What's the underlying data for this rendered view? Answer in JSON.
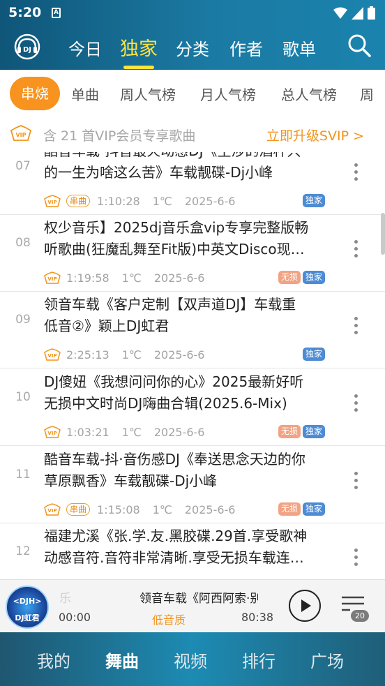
{
  "status": {
    "time": "5:20",
    "a_icon": "A"
  },
  "topnav": {
    "logo_text": "DJ",
    "tabs": [
      {
        "label": "今日"
      },
      {
        "label": "独家"
      },
      {
        "label": "分类"
      },
      {
        "label": "作者"
      },
      {
        "label": "歌单"
      }
    ],
    "active_tab": "独家"
  },
  "chips": [
    {
      "label": "串烧"
    },
    {
      "label": "单曲"
    },
    {
      "label": "周人气榜"
    },
    {
      "label": "月人气榜"
    },
    {
      "label": "总人气榜"
    },
    {
      "label": "周"
    }
  ],
  "vip_bar": {
    "badge": "VIP",
    "text": "含 21 首VIP会员专享歌曲",
    "upgrade": "立即升级SVIP >"
  },
  "songs": [
    {
      "num": "07",
      "title": "酷音车载-抖音最火劲感DJ《生涉的酒杯只的一生为啥这么苦》车载靓碟-Dj小峰",
      "line1": "酷音车载-抖音最火动感DJ《生涉的酒杯只",
      "line2": "的一生为啥这么苦》车载靓碟-Dj小峰",
      "chuan": "串曲",
      "duration": "1:10:28",
      "temp": "1℃",
      "date": "2025-6-6",
      "tags": [
        "独家"
      ]
    },
    {
      "num": "08",
      "line1": "权少音乐】2025dj音乐盒vip专享完整版畅",
      "line2": "听歌曲(狂魔乱舞至Fit版)中英文Disco现…",
      "chuan": "",
      "duration": "1:19:58",
      "temp": "1℃",
      "date": "2025-6-6",
      "tags": [
        "无损",
        "独家"
      ]
    },
    {
      "num": "09",
      "line1": "领音车载《客户定制【双声道DJ】车载重",
      "line2": "低音②》颖上DJ虹君",
      "chuan": "",
      "duration": "2:25:13",
      "temp": "1℃",
      "date": "2025-6-6",
      "tags": [
        "独家"
      ]
    },
    {
      "num": "10",
      "line1": "DJ傻妞《我想问问你的心》2025最新好听",
      "line2": "无损中文时尚DJ嗨曲合辑(2025.6-Mix)",
      "chuan": "",
      "duration": "1:03:21",
      "temp": "1℃",
      "date": "2025-6-6",
      "tags": [
        "无损",
        "独家"
      ]
    },
    {
      "num": "11",
      "line1": "酷音车载-抖·音伤感DJ《奉送思念天边的你",
      "line2": "草原飘香》车载靓碟-Dj小峰",
      "chuan": "串曲",
      "duration": "1:15:08",
      "temp": "1℃",
      "date": "2025-6-6",
      "tags": [
        "无损",
        "独家"
      ]
    },
    {
      "num": "12",
      "line1": "福建尤溪《张.学.友.黑胶碟.29首.享受歌神",
      "line2": "动感音符.音符非常清晰.享受无损车载连…",
      "chuan": "",
      "duration": "",
      "temp": "",
      "date": "",
      "tags": []
    }
  ],
  "player": {
    "disc_top": "<DJH>",
    "disc_bottom": "DJ虹君",
    "ghost_text": "乐",
    "title": "领音车载《阿西阿索·别啊",
    "current_time": "00:00",
    "quality": "低音质",
    "duration": "80:38",
    "queue_count": "20"
  },
  "bottomnav": [
    {
      "label": "我的"
    },
    {
      "label": "舞曲"
    },
    {
      "label": "视频"
    },
    {
      "label": "排行"
    },
    {
      "label": "广场"
    }
  ],
  "colors": {
    "accent": "#f7931e",
    "active_tab": "#ffe33a",
    "exclusive_tag": "#4d8bd4",
    "lossless_tag": "#f1a383"
  }
}
